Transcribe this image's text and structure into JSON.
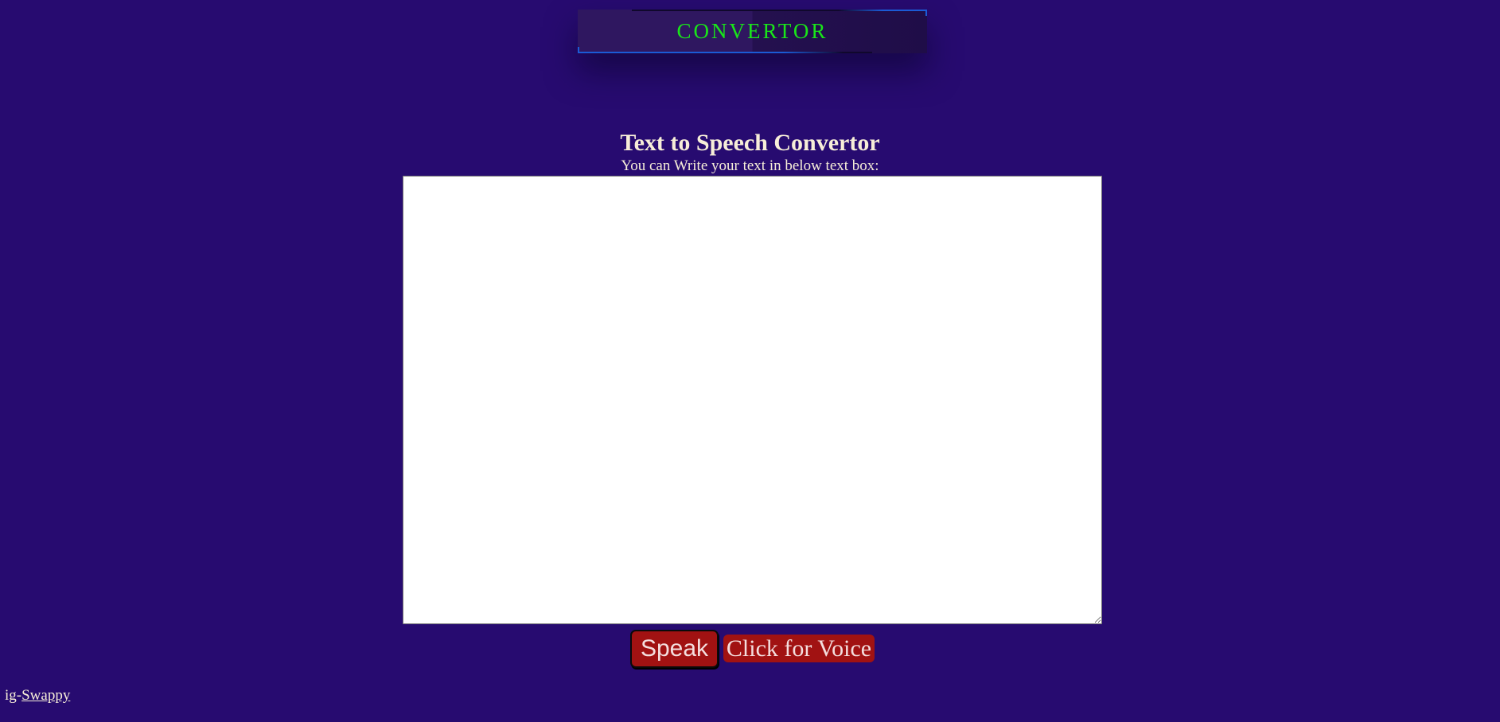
{
  "header": {
    "brand_title": "CONVERTOR"
  },
  "main": {
    "heading": "Text to Speech Convertor",
    "subheading": "You can Write your text in below text box:",
    "text_input": {
      "value": "",
      "placeholder": ""
    },
    "speak_label": "Speak",
    "voice_label": "Click for Voice"
  },
  "footer": {
    "prefix": "ig-",
    "link_label": "Swappy"
  },
  "colors": {
    "background": "#270b70",
    "brand_text": "#19e619",
    "button_bg": "#a11212",
    "text": "#f7eed8"
  }
}
